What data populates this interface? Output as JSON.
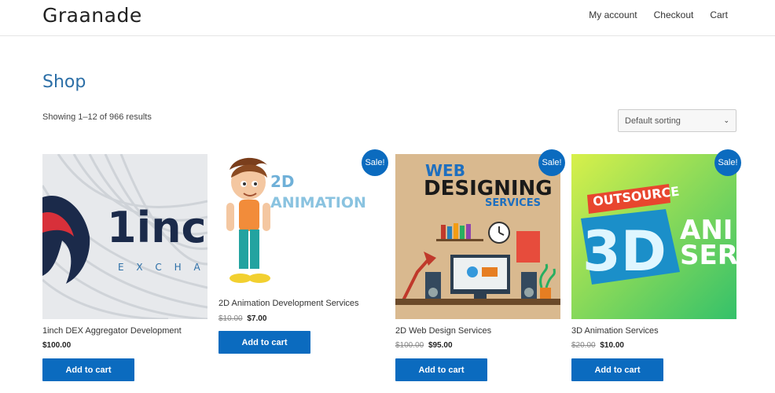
{
  "site": {
    "title": "Graanade"
  },
  "nav": {
    "items": [
      "My account",
      "Checkout",
      "Cart"
    ]
  },
  "page": {
    "title": "Shop",
    "result_count": "Showing 1–12 of 966 results",
    "sorting": "Default sorting"
  },
  "products": [
    {
      "name": "1inch DEX Aggregator Development",
      "old_price": "",
      "price": "$100.00",
      "on_sale": false,
      "button": "Add to cart",
      "image_text": [
        "1inc",
        "E X C H A"
      ]
    },
    {
      "name": "2D Animation Development Services",
      "old_price": "$10.00",
      "price": "$7.00",
      "on_sale": true,
      "sale_label": "Sale!",
      "button": "Add to cart",
      "image_text": [
        "2D",
        "ANIMATION"
      ]
    },
    {
      "name": "2D Web Design Services",
      "old_price": "$100.00",
      "price": "$95.00",
      "on_sale": true,
      "sale_label": "Sale!",
      "button": "Add to cart",
      "image_text": [
        "WEB",
        "DESIGNING",
        "SERVICES"
      ]
    },
    {
      "name": "3D Animation Services",
      "old_price": "$20.00",
      "price": "$10.00",
      "on_sale": true,
      "sale_label": "Sale!",
      "button": "Add to cart",
      "image_text": [
        "OUTSOURCE",
        "3D",
        "ANI",
        "SER"
      ]
    }
  ],
  "colors": {
    "accent": "#0b6bbf",
    "title": "#2c6fa7"
  }
}
